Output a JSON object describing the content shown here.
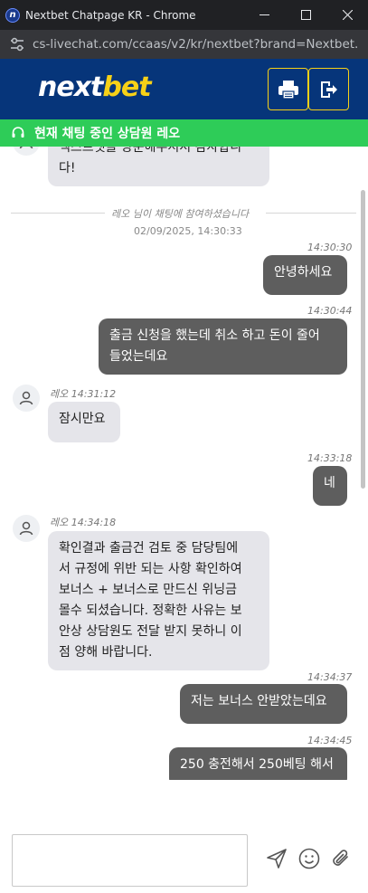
{
  "window": {
    "title": "Nextbet Chatpage KR - Chrome",
    "url": "cs-livechat.com/ccaas/v2/kr/nextbet?brand=Nextbet..."
  },
  "brand": {
    "logo_part1": "next",
    "logo_part2": "bet"
  },
  "agent_bar": {
    "text": "현재 채팅 중인 상담원 레오"
  },
  "system": {
    "joined": "레오 님이 채팅에 참여하셨습니다",
    "date": "02/09/2025, 14:30:33"
  },
  "messages": [
    {
      "dir": "in",
      "time": "",
      "text_lines": [
        "넥스트벳을 방문해주셔서 감사합니",
        "다!"
      ]
    },
    {
      "dir": "out",
      "time": "14:30:30",
      "text_lines": [
        "안녕하세요"
      ]
    },
    {
      "dir": "out",
      "time": "14:30:44",
      "text_lines": [
        "출금 신청을 했는데 취소 하고 돈이 줄어",
        "들었는데요"
      ]
    },
    {
      "dir": "in",
      "sender": "레오",
      "time": "14:31:12",
      "text_lines": [
        "잠시만요"
      ]
    },
    {
      "dir": "out",
      "time": "14:33:18",
      "text_lines": [
        "네"
      ]
    },
    {
      "dir": "in",
      "sender": "레오",
      "time": "14:34:18",
      "text_lines": [
        "확인결과 출금건 검토 중 담당팀에",
        "서 규정에 위반 되는 사항 확인하여",
        "보너스 + 보너스로 만드신 위닝금",
        "몰수 되셨습니다. 정확한 사유는 보",
        "안상 상담원도 전달 받지 못하니 이",
        "점 양해 바랍니다."
      ]
    },
    {
      "dir": "out",
      "time": "14:34:37",
      "text_lines": [
        "저는 보너스 안받았는데요"
      ]
    },
    {
      "dir": "out",
      "time": "14:34:45",
      "text_lines": [
        "250 충전해서 250베팅 해서"
      ]
    }
  ],
  "composer": {
    "input_value": "",
    "input_placeholder": ""
  },
  "icons": {
    "favicon": "nextbet-favicon",
    "tune": "site-info-icon",
    "print": "print-icon",
    "exit": "exit-icon",
    "headset": "headset-icon",
    "avatar": "user-avatar-icon",
    "send": "send-icon",
    "emoji": "emoji-icon",
    "attach": "paperclip-icon"
  },
  "colors": {
    "brand_blue": "#06357a",
    "brand_yellow": "#f7d117",
    "agent_green": "#2ecc58",
    "bubble_in": "#e5e5ea",
    "bubble_out": "#5e5e5e"
  }
}
